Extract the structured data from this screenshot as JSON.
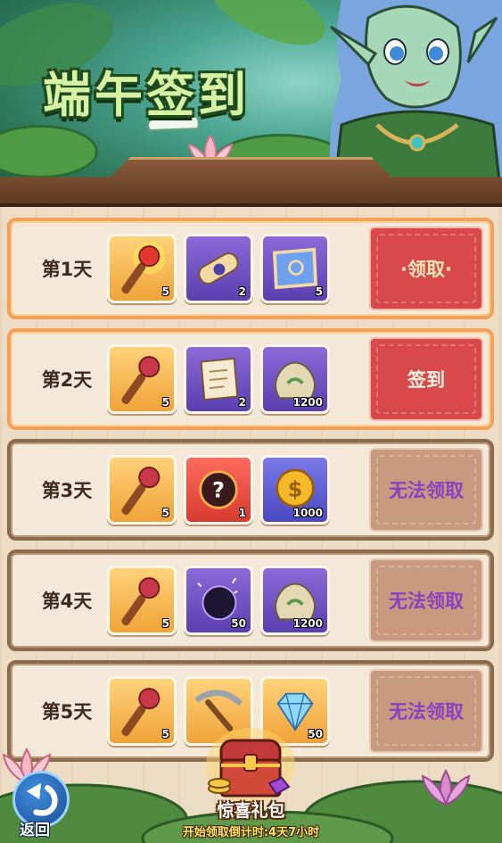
{
  "banner": {
    "title": "端午签到"
  },
  "days": [
    {
      "label": "第1天",
      "state": "claim",
      "action": "·领取·",
      "rewards": [
        {
          "icon": "firework-wand-icon",
          "count": "5",
          "bg": "gold"
        },
        {
          "icon": "rolled-scroll-icon",
          "count": "2",
          "bg": "purple"
        },
        {
          "icon": "blue-scroll-icon",
          "count": "5",
          "bg": "purple"
        }
      ]
    },
    {
      "label": "第2天",
      "state": "sign",
      "action": "签到",
      "rewards": [
        {
          "icon": "candy-wand-icon",
          "count": "5",
          "bg": "gold"
        },
        {
          "icon": "open-scroll-icon",
          "count": "2",
          "bg": "purple"
        },
        {
          "icon": "money-bag-icon",
          "count": "1200",
          "bg": "purple"
        }
      ]
    },
    {
      "label": "第3天",
      "state": "locked",
      "action": "无法领取",
      "rewards": [
        {
          "icon": "candy-wand-icon",
          "count": "5",
          "bg": "gold"
        },
        {
          "icon": "mystery-box-icon",
          "count": "1",
          "bg": "red"
        },
        {
          "icon": "gold-coin-icon",
          "count": "1000",
          "bg": "blue"
        }
      ]
    },
    {
      "label": "第4天",
      "state": "locked",
      "action": "无法领取",
      "rewards": [
        {
          "icon": "candy-wand-icon",
          "count": "5",
          "bg": "gold"
        },
        {
          "icon": "dark-orb-icon",
          "count": "50",
          "bg": "purple"
        },
        {
          "icon": "money-bag-icon",
          "count": "1200",
          "bg": "purple"
        }
      ]
    },
    {
      "label": "第5天",
      "state": "locked",
      "action": "无法领取",
      "rewards": [
        {
          "icon": "candy-wand-icon",
          "count": "5",
          "bg": "gold"
        },
        {
          "icon": "pickaxe-icon",
          "count": "",
          "bg": "gold"
        },
        {
          "icon": "diamond-icon",
          "count": "50",
          "bg": "gold"
        }
      ]
    }
  ],
  "footer": {
    "back_label": "返回",
    "gift_label": "惊喜礼包",
    "countdown": "开始领取倒计时:4天7小时"
  },
  "colors": {
    "active_border": "#f3a05a",
    "locked_border": "#8c6a4e",
    "claim_button": "#d9484a",
    "locked_button": "#c9997f",
    "locked_text": "#8c3ec4"
  }
}
